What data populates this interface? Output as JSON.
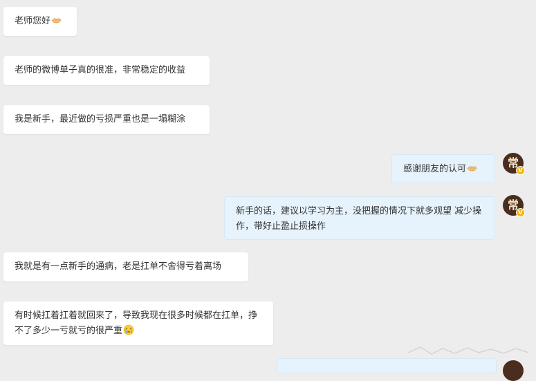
{
  "chat": {
    "messages": [
      {
        "side": "in",
        "text": "老师您好",
        "emoji": "handshake-emoji"
      },
      {
        "side": "in",
        "text": "老师的微博单子真的很准，非常稳定的收益"
      },
      {
        "side": "in",
        "text": "我是新手，最近做的亏损严重也是一塌糊涂"
      },
      {
        "side": "out",
        "text": "感谢朋友的认可",
        "emoji": "handshake-emoji"
      },
      {
        "side": "out",
        "text": "新手的话，建议以学习为主，没把握的情况下就多观望 减少操作，带好止盈止损操作"
      },
      {
        "side": "in",
        "text": "我就是有一点新手的通病，老是扛单不舍得亏着离场"
      },
      {
        "side": "in",
        "text": "有时候扛着扛着就回来了，导致我现在很多时候都在扛单，挣不了多少一亏就亏的很严重",
        "emoji": "crying-face-emoji"
      }
    ]
  },
  "avatar": {
    "glyph": "常",
    "badge": "V",
    "background": "#4a2d1f",
    "badge_color": "#f7b500"
  },
  "colors": {
    "background": "#ededed",
    "incoming_bubble": "#ffffff",
    "outgoing_bubble": "#e6f2fc",
    "text": "#333333"
  }
}
